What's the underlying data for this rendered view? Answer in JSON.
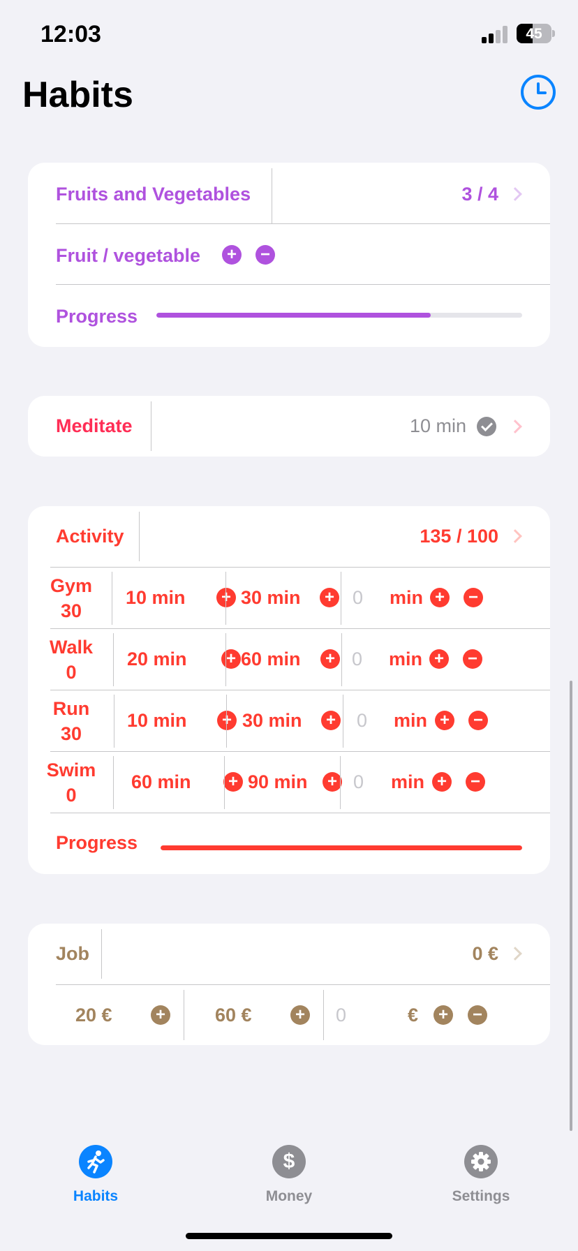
{
  "status_bar": {
    "time": "12:03",
    "battery": "45",
    "battery_level": 0.45
  },
  "header": {
    "title": "Habits",
    "history_icon": "clock-icon"
  },
  "fruits": {
    "title": "Fruits and Vegetables",
    "count": "3 / 4",
    "counter_label": "Fruit / vegetable",
    "progress_label": "Progress",
    "progress": 0.75,
    "color": "#af52de"
  },
  "meditate": {
    "title": "Meditate",
    "value": "10 min",
    "color": "#ff2d55"
  },
  "activity": {
    "title": "Activity",
    "count": "135 / 100",
    "progress_label": "Progress",
    "progress": 1.0,
    "color": "#ff3b30",
    "rows": [
      {
        "name": "Gym",
        "total": "30",
        "opt1": "10 min",
        "opt2": "30 min",
        "custom_value": "0",
        "unit": "min"
      },
      {
        "name": "Walk",
        "total": "0",
        "opt1": "20 min",
        "opt2": "60 min",
        "custom_value": "0",
        "unit": "min"
      },
      {
        "name": "Run",
        "total": "30",
        "opt1": "10 min",
        "opt2": "30 min",
        "custom_value": "0",
        "unit": "min"
      },
      {
        "name": "Swim",
        "total": "0",
        "opt1": "60 min",
        "opt2": "90 min",
        "custom_value": "0",
        "unit": "min"
      }
    ]
  },
  "job": {
    "title": "Job",
    "value": "0 €",
    "opt1": "20 €",
    "opt2": "60 €",
    "custom_value": "0",
    "unit": "€",
    "color": "#a2845e"
  },
  "tabs": [
    {
      "label": "Habits",
      "icon": "runner-icon",
      "active": true,
      "color": "#0a84ff"
    },
    {
      "label": "Money",
      "icon": "dollar-icon",
      "active": false,
      "color": "#8e8e93"
    },
    {
      "label": "Settings",
      "icon": "gear-icon",
      "active": false,
      "color": "#8e8e93"
    }
  ]
}
